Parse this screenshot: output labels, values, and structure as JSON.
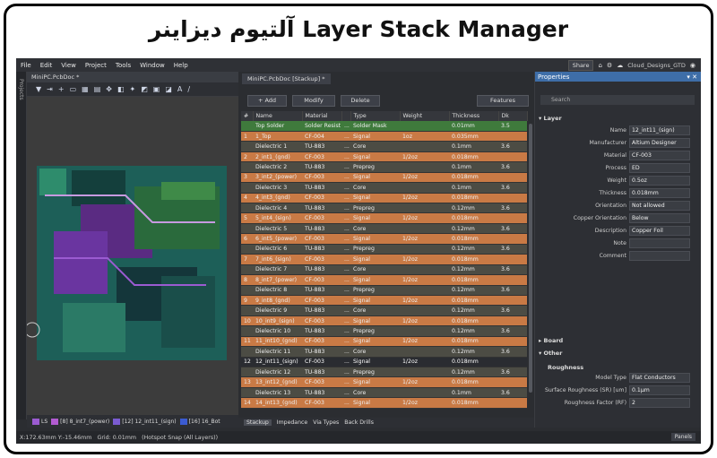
{
  "banner": {
    "title": "آلتیوم دیزاینر Layer Stack Manager"
  },
  "menu": [
    "File",
    "Edit",
    "View",
    "Project",
    "Tools",
    "Window",
    "Help"
  ],
  "topbar": {
    "share": "Share",
    "account": "Cloud_Designs_GTD"
  },
  "left_panel": {
    "label": "Projects"
  },
  "pcb": {
    "tab": "MiniPC.PcbDoc *"
  },
  "stack": {
    "tab": "MiniPC.PcbDoc [Stackup] *",
    "buttons": {
      "add": "+ Add",
      "modify": "Modify",
      "delete": "Delete",
      "features": "Features"
    },
    "columns": [
      "#",
      "Name",
      "Material",
      "",
      "Type",
      "Weight",
      "Thickness",
      "Dk"
    ],
    "rows": [
      {
        "n": "",
        "name": "Top Solder",
        "mat": "Solder Resist",
        "dots": "...",
        "type": "Solder Mask",
        "w": "",
        "t": "0.01mm",
        "dk": "3.5",
        "k": "solder"
      },
      {
        "n": "1",
        "name": "1_Top",
        "mat": "CF-004",
        "dots": "...",
        "type": "Signal",
        "w": "1oz",
        "t": "0.035mm",
        "dk": "",
        "k": "signal"
      },
      {
        "n": "",
        "name": "Dielectric 1",
        "mat": "TU-883",
        "dots": "...",
        "type": "Core",
        "w": "",
        "t": "0.1mm",
        "dk": "3.6",
        "k": "diel"
      },
      {
        "n": "2",
        "name": "2_int1_(gnd)",
        "mat": "CF-003",
        "dots": "...",
        "type": "Signal",
        "w": "1/2oz",
        "t": "0.018mm",
        "dk": "",
        "k": "signal"
      },
      {
        "n": "",
        "name": "Dielectric 2",
        "mat": "TU-883",
        "dots": "...",
        "type": "Prepreg",
        "w": "",
        "t": "0.1mm",
        "dk": "3.6",
        "k": "diel"
      },
      {
        "n": "3",
        "name": "3_int2_(power)",
        "mat": "CF-003",
        "dots": "...",
        "type": "Signal",
        "w": "1/2oz",
        "t": "0.018mm",
        "dk": "",
        "k": "signal"
      },
      {
        "n": "",
        "name": "Dielectric 3",
        "mat": "TU-883",
        "dots": "...",
        "type": "Core",
        "w": "",
        "t": "0.1mm",
        "dk": "3.6",
        "k": "diel"
      },
      {
        "n": "4",
        "name": "4_int3_(gnd)",
        "mat": "CF-003",
        "dots": "...",
        "type": "Signal",
        "w": "1/2oz",
        "t": "0.018mm",
        "dk": "",
        "k": "signal"
      },
      {
        "n": "",
        "name": "Dielectric 4",
        "mat": "TU-883",
        "dots": "...",
        "type": "Prepreg",
        "w": "",
        "t": "0.12mm",
        "dk": "3.6",
        "k": "diel"
      },
      {
        "n": "5",
        "name": "5_int4_(sign)",
        "mat": "CF-003",
        "dots": "...",
        "type": "Signal",
        "w": "1/2oz",
        "t": "0.018mm",
        "dk": "",
        "k": "signal"
      },
      {
        "n": "",
        "name": "Dielectric 5",
        "mat": "TU-883",
        "dots": "...",
        "type": "Core",
        "w": "",
        "t": "0.12mm",
        "dk": "3.6",
        "k": "diel"
      },
      {
        "n": "6",
        "name": "6_int5_(power)",
        "mat": "CF-003",
        "dots": "...",
        "type": "Signal",
        "w": "1/2oz",
        "t": "0.018mm",
        "dk": "",
        "k": "signal"
      },
      {
        "n": "",
        "name": "Dielectric 6",
        "mat": "TU-883",
        "dots": "...",
        "type": "Prepreg",
        "w": "",
        "t": "0.12mm",
        "dk": "3.6",
        "k": "diel"
      },
      {
        "n": "7",
        "name": "7_int6_(sign)",
        "mat": "CF-003",
        "dots": "...",
        "type": "Signal",
        "w": "1/2oz",
        "t": "0.018mm",
        "dk": "",
        "k": "signal"
      },
      {
        "n": "",
        "name": "Dielectric 7",
        "mat": "TU-883",
        "dots": "...",
        "type": "Core",
        "w": "",
        "t": "0.12mm",
        "dk": "3.6",
        "k": "diel"
      },
      {
        "n": "8",
        "name": "8_int7_(power)",
        "mat": "CF-003",
        "dots": "...",
        "type": "Signal",
        "w": "1/2oz",
        "t": "0.018mm",
        "dk": "",
        "k": "signal"
      },
      {
        "n": "",
        "name": "Dielectric 8",
        "mat": "TU-883",
        "dots": "...",
        "type": "Prepreg",
        "w": "",
        "t": "0.12mm",
        "dk": "3.6",
        "k": "diel"
      },
      {
        "n": "9",
        "name": "9_int8_(gnd)",
        "mat": "CF-003",
        "dots": "...",
        "type": "Signal",
        "w": "1/2oz",
        "t": "0.018mm",
        "dk": "",
        "k": "signal"
      },
      {
        "n": "",
        "name": "Dielectric 9",
        "mat": "TU-883",
        "dots": "...",
        "type": "Core",
        "w": "",
        "t": "0.12mm",
        "dk": "3.6",
        "k": "diel"
      },
      {
        "n": "10",
        "name": "10_int9_(sign)",
        "mat": "CF-003",
        "dots": "...",
        "type": "Signal",
        "w": "1/2oz",
        "t": "0.018mm",
        "dk": "",
        "k": "signal"
      },
      {
        "n": "",
        "name": "Dielectric 10",
        "mat": "TU-883",
        "dots": "...",
        "type": "Prepreg",
        "w": "",
        "t": "0.12mm",
        "dk": "3.6",
        "k": "diel"
      },
      {
        "n": "11",
        "name": "11_int10_(gnd)",
        "mat": "CF-003",
        "dots": "...",
        "type": "Signal",
        "w": "1/2oz",
        "t": "0.018mm",
        "dk": "",
        "k": "signal"
      },
      {
        "n": "",
        "name": "Dielectric 11",
        "mat": "TU-883",
        "dots": "...",
        "type": "Core",
        "w": "",
        "t": "0.12mm",
        "dk": "3.6",
        "k": "diel"
      },
      {
        "n": "12",
        "name": "12_int11_(sign)",
        "mat": "CF-003",
        "dots": "...",
        "type": "Signal",
        "w": "1/2oz",
        "t": "0.018mm",
        "dk": "",
        "k": "selected"
      },
      {
        "n": "",
        "name": "Dielectric 12",
        "mat": "TU-883",
        "dots": "...",
        "type": "Prepreg",
        "w": "",
        "t": "0.12mm",
        "dk": "3.6",
        "k": "diel"
      },
      {
        "n": "13",
        "name": "13_int12_(gnd)",
        "mat": "CF-003",
        "dots": "...",
        "type": "Signal",
        "w": "1/2oz",
        "t": "0.018mm",
        "dk": "",
        "k": "signal"
      },
      {
        "n": "",
        "name": "Dielectric 13",
        "mat": "TU-883",
        "dots": "...",
        "type": "Core",
        "w": "",
        "t": "0.1mm",
        "dk": "3.6",
        "k": "diel"
      },
      {
        "n": "14",
        "name": "14_int13_(gnd)",
        "mat": "CF-003",
        "dots": "...",
        "type": "Signal",
        "w": "1/2oz",
        "t": "0.018mm",
        "dk": "",
        "k": "signal"
      }
    ],
    "bottom_tabs": [
      "Stackup",
      "Impedance",
      "Via Types",
      "Back Drills"
    ]
  },
  "properties": {
    "title": "Properties",
    "search": "Search",
    "section_layer": "Layer",
    "fields": [
      {
        "label": "Name",
        "value": "12_int11_(sign)"
      },
      {
        "label": "Manufacturer",
        "value": "Altium Designer"
      },
      {
        "label": "Material",
        "value": "CF-003"
      },
      {
        "label": "Process",
        "value": "ED"
      },
      {
        "label": "Weight",
        "value": "0.5oz"
      },
      {
        "label": "Thickness",
        "value": "0.018mm"
      },
      {
        "label": "Orientation",
        "value": "Not allowed"
      },
      {
        "label": "Copper Orientation",
        "value": "Below"
      },
      {
        "label": "Description",
        "value": "Copper Foil"
      },
      {
        "label": "Note",
        "value": ""
      },
      {
        "label": "Comment",
        "value": ""
      }
    ],
    "section_board": "Board",
    "section_other": "Other",
    "roughness": "Roughness",
    "rough_fields": [
      {
        "label": "Model Type",
        "value": "Flat Conductors"
      },
      {
        "label": "Surface Roughness (SR) [um]",
        "value": "0.1μm"
      },
      {
        "label": "Roughness Factor (RF)",
        "value": "2"
      }
    ]
  },
  "layerbar": {
    "items": [
      "LS",
      "[8] 8_int7_(power)",
      "[12] 12_int11_(sign)",
      "[16] 16_Bot"
    ]
  },
  "status": {
    "coords": "X:172.63mm Y:-15.46mm",
    "grid": "Grid: 0.01mm",
    "snap": "(Hotspot Snap (All Layers))",
    "panels": "Panels"
  }
}
